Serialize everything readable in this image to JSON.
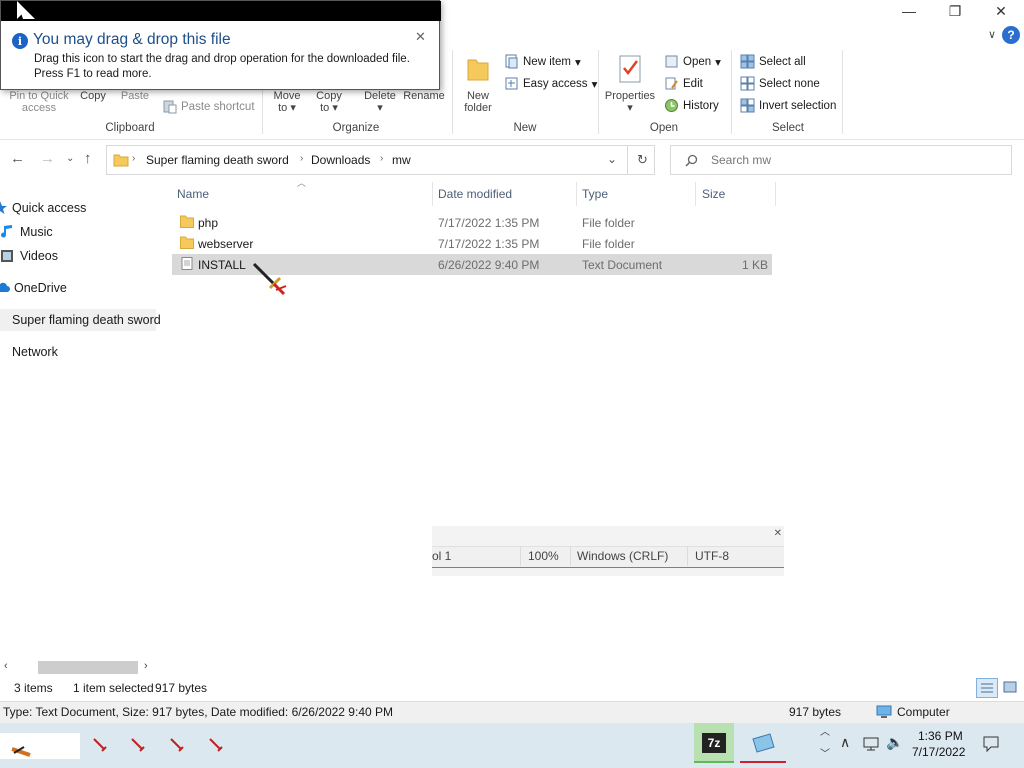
{
  "window": {
    "minimize": "—",
    "maximize": "❐",
    "close": "✕",
    "help": "?",
    "collapse": "∨"
  },
  "notification": {
    "title": "You may drag & drop this file",
    "body": "Drag this icon to start the drag and drop operation for the downloaded file. Press F1 to read more.",
    "close": "✕"
  },
  "ribbon": {
    "clipboard": {
      "pin_line1": "Pin to Quick",
      "pin_line2": "access",
      "copy": "Copy",
      "paste": "Paste",
      "paste_shortcut": "Paste shortcut",
      "label": "Clipboard"
    },
    "organize": {
      "move_line1": "Move",
      "move_line2": "to",
      "copy_line1": "Copy",
      "copy_line2": "to",
      "delete": "Delete",
      "rename": "Rename",
      "label": "Organize"
    },
    "new": {
      "new_folder_line1": "New",
      "new_folder_line2": "folder",
      "new_item": "New item",
      "easy_access": "Easy access",
      "label": "New"
    },
    "open": {
      "properties": "Properties",
      "open": "Open",
      "edit": "Edit",
      "history": "History",
      "label": "Open"
    },
    "select": {
      "select_all": "Select all",
      "select_none": "Select none",
      "invert": "Invert selection",
      "label": "Select"
    }
  },
  "address": {
    "crumbs": [
      "Super flaming death sword",
      "Downloads",
      "mw"
    ],
    "search_placeholder": "Search mw"
  },
  "nav": {
    "items": [
      "Quick access",
      "Music",
      "Videos",
      "OneDrive",
      "Super flaming death sword",
      "Network"
    ]
  },
  "columns": [
    "Name",
    "Date modified",
    "Type",
    "Size"
  ],
  "files": [
    {
      "name": "php",
      "date": "7/17/2022 1:35 PM",
      "type": "File folder",
      "size": ""
    },
    {
      "name": "webserver",
      "date": "7/17/2022 1:35 PM",
      "type": "File folder",
      "size": ""
    },
    {
      "name": "INSTALL",
      "date": "6/26/2022 9:40 PM",
      "type": "Text Document",
      "size": "1 KB"
    }
  ],
  "ghost_status": {
    "col": "ol 1",
    "zoom": "100%",
    "eol": "Windows (CRLF)",
    "encoding": "UTF-8"
  },
  "status": {
    "items": "3 items",
    "selected": "1 item selected",
    "bytes": "917 bytes"
  },
  "info": {
    "details": "Type: Text Document, Size: 917 bytes, Date modified: 6/26/2022 9:40 PM",
    "size": "917 bytes",
    "location": "Computer"
  },
  "taskbar": {
    "time": "1:36 PM",
    "date": "7/17/2022",
    "app_7z": "7z"
  },
  "colors": {
    "accent": "#1e4f8a",
    "folder": "#f5c95b",
    "selection": "#d9d9d9"
  }
}
